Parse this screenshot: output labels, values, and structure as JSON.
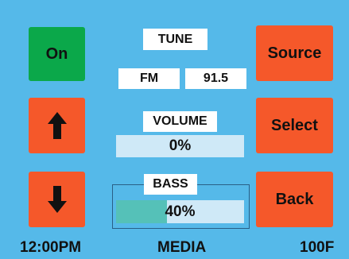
{
  "buttons": {
    "on": {
      "label": "On",
      "color": "#0ba84a"
    },
    "source": {
      "label": "Source",
      "color": "#f5582a"
    },
    "select": {
      "label": "Select",
      "color": "#f5582a"
    },
    "back": {
      "label": "Back",
      "color": "#f5582a"
    },
    "up": {
      "icon": "arrow-up-icon"
    },
    "down": {
      "icon": "arrow-down-icon"
    }
  },
  "tune": {
    "label": "TUNE",
    "band": "FM",
    "frequency": "91.5"
  },
  "volume": {
    "label": "VOLUME",
    "value_text": "0%",
    "level": 0
  },
  "bass": {
    "label": "BASS",
    "value_text": "40%",
    "level": 0.4
  },
  "status_bar": {
    "time": "12:00PM",
    "mode": "MEDIA",
    "temperature": "100F"
  },
  "colors": {
    "background": "#55b9e9",
    "bar_track": "#cfe9f7",
    "bar_fill": "#55c1b8"
  }
}
